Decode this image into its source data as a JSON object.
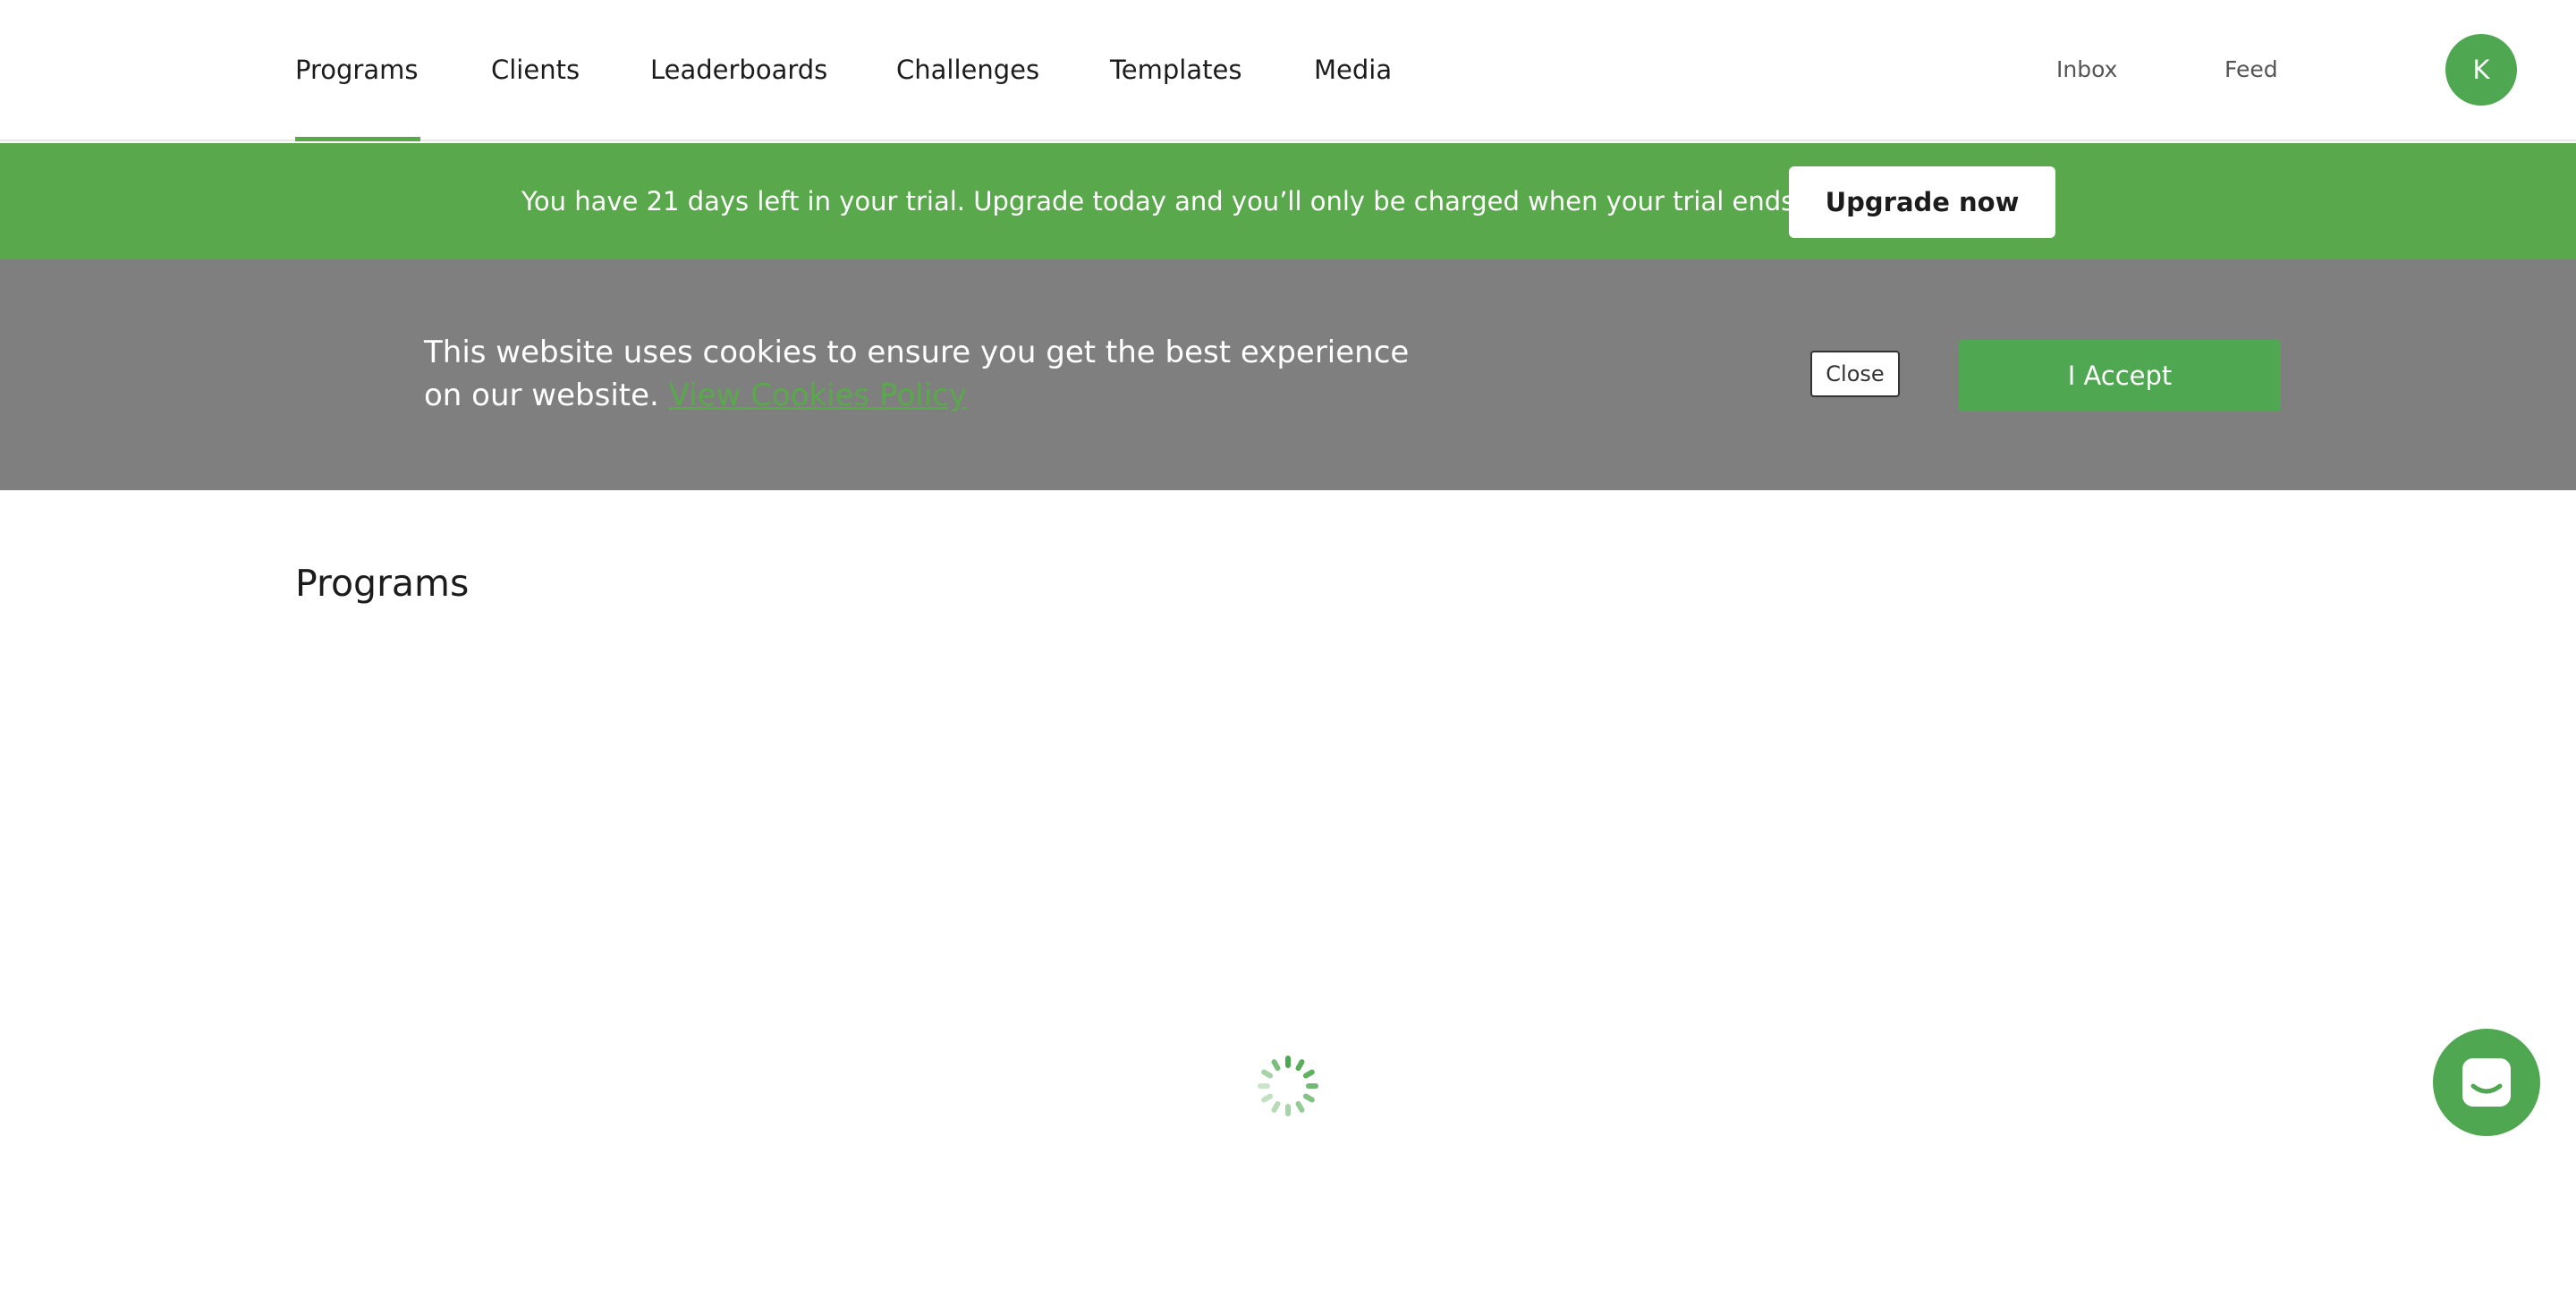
{
  "nav": {
    "items": [
      {
        "label": "Programs",
        "active": true
      },
      {
        "label": "Clients"
      },
      {
        "label": "Leaderboards"
      },
      {
        "label": "Challenges"
      },
      {
        "label": "Templates"
      },
      {
        "label": "Media"
      }
    ],
    "inbox": "Inbox",
    "feed": "Feed",
    "avatar_initial": "K"
  },
  "trial_banner": {
    "message": "You have 21 days left in your trial. Upgrade today and you’ll only be charged when your trial ends.",
    "button": "Upgrade now"
  },
  "cookie_banner": {
    "text": "This website uses cookies to ensure you get the best experience on our website.",
    "link": "View Cookies Policy",
    "close": "Close",
    "accept": "I Accept"
  },
  "main": {
    "title": "Programs",
    "loading_icon": "spinner-icon"
  },
  "chat": {
    "icon": "chat-icon"
  },
  "colors": {
    "brand_green": "#5aa84c",
    "cookie_gray": "#7f7f7f"
  }
}
